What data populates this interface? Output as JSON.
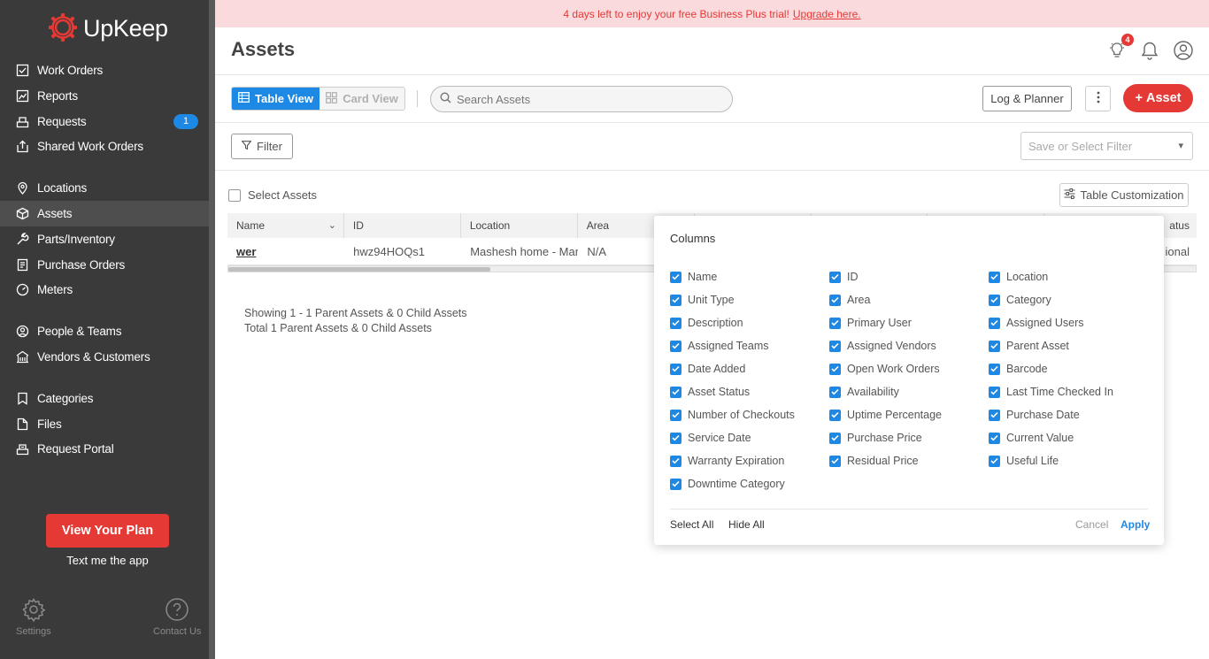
{
  "brand": {
    "name": "UpKeep",
    "logo_color": "#e53935"
  },
  "sidebar": {
    "items": [
      {
        "label": "Work Orders",
        "icon": "work-orders-icon"
      },
      {
        "label": "Reports",
        "icon": "reports-icon"
      },
      {
        "label": "Requests",
        "icon": "requests-icon",
        "badge": "1"
      },
      {
        "label": "Shared Work Orders",
        "icon": "shared-icon"
      },
      {
        "label": "Locations",
        "icon": "location-icon"
      },
      {
        "label": "Assets",
        "icon": "cube-icon",
        "active": true
      },
      {
        "label": "Parts/Inventory",
        "icon": "wrench-icon"
      },
      {
        "label": "Purchase Orders",
        "icon": "document-icon"
      },
      {
        "label": "Meters",
        "icon": "meter-icon"
      },
      {
        "label": "People & Teams",
        "icon": "people-icon"
      },
      {
        "label": "Vendors & Customers",
        "icon": "vendors-icon"
      },
      {
        "label": "Categories",
        "icon": "category-icon"
      },
      {
        "label": "Files",
        "icon": "files-icon"
      },
      {
        "label": "Request Portal",
        "icon": "portal-icon"
      }
    ],
    "plan_button": "View Your Plan",
    "text_app": "Text me the app",
    "settings": "Settings",
    "contact": "Contact Us"
  },
  "banner": {
    "text": "4 days left to enjoy your free Business Plus trial!",
    "link": "Upgrade here."
  },
  "header": {
    "title": "Assets",
    "notification_badge": "4"
  },
  "toolbar": {
    "table_view": "Table View",
    "card_view": "Card View",
    "search_placeholder": "Search Assets",
    "log_planner": "Log & Planner",
    "add_asset": "Asset"
  },
  "filterbar": {
    "filter": "Filter",
    "save_filter_placeholder": "Save or Select Filter"
  },
  "content": {
    "select_assets": "Select Assets",
    "table_customization": "Table Customization",
    "columns": [
      "Name",
      "ID",
      "Location",
      "Area",
      "",
      "",
      "",
      "",
      "atus"
    ],
    "rows": [
      {
        "name": "wer",
        "id": "hwz94HOQs1",
        "location": "Mashesh home - Marathi",
        "area": "N/A",
        "status": "ional"
      }
    ],
    "showing_line1": "Showing 1 - 1 Parent Assets & 0 Child Assets",
    "showing_line2": "Total 1 Parent Assets & 0 Child Assets"
  },
  "columns_popup": {
    "title": "Columns",
    "col1": [
      "Name",
      "Unit Type",
      "Description",
      "Assigned Teams",
      "Date Added",
      "Asset Status",
      "Number of Checkouts",
      "Service Date",
      "Warranty Expiration",
      "Downtime Category"
    ],
    "col2": [
      "ID",
      "Area",
      "Primary User",
      "Assigned Vendors",
      "Open Work Orders",
      "Availability",
      "Uptime Percentage",
      "Purchase Price",
      "Residual Price"
    ],
    "col3": [
      "Location",
      "Category",
      "Assigned Users",
      "Parent Asset",
      "Barcode",
      "Last Time Checked In",
      "Purchase Date",
      "Current Value",
      "Useful Life"
    ],
    "select_all": "Select All",
    "hide_all": "Hide All",
    "cancel": "Cancel",
    "apply": "Apply",
    "accent": "#1e88e5"
  }
}
